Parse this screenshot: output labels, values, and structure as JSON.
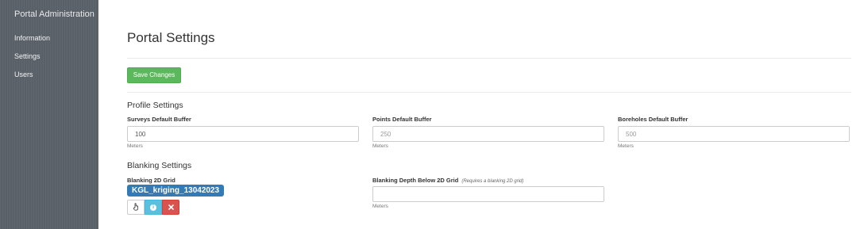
{
  "sidebar": {
    "brand": "Portal Administration",
    "items": [
      {
        "label": "Information"
      },
      {
        "label": "Settings"
      },
      {
        "label": "Users"
      }
    ]
  },
  "page": {
    "title": "Portal Settings",
    "save_label": "Save Changes"
  },
  "profile": {
    "title": "Profile Settings",
    "fields": [
      {
        "label": "Surveys Default Buffer",
        "value": "100",
        "placeholder": "",
        "help": "Meters"
      },
      {
        "label": "Points Default Buffer",
        "value": "",
        "placeholder": "250",
        "help": "Meters"
      },
      {
        "label": "Boreholes Default Buffer",
        "value": "",
        "placeholder": "500",
        "help": "Meters"
      }
    ]
  },
  "blanking": {
    "title": "Blanking Settings",
    "grid_label": "Blanking 2D Grid",
    "grid_value": "KGL_kriging_13042023",
    "depth_label": "Blanking Depth Below 2D Grid",
    "depth_note": "(Requires a blanking 2D grid)",
    "depth_value": "",
    "depth_help": "Meters"
  },
  "icons": {
    "select": "pointer-icon",
    "info": "info-icon",
    "remove": "close-icon"
  },
  "colors": {
    "sidebar_bg": "#5a6068",
    "success": "#5cb85c",
    "primary": "#337ab7",
    "info": "#5bc0de",
    "danger": "#d9534f"
  }
}
